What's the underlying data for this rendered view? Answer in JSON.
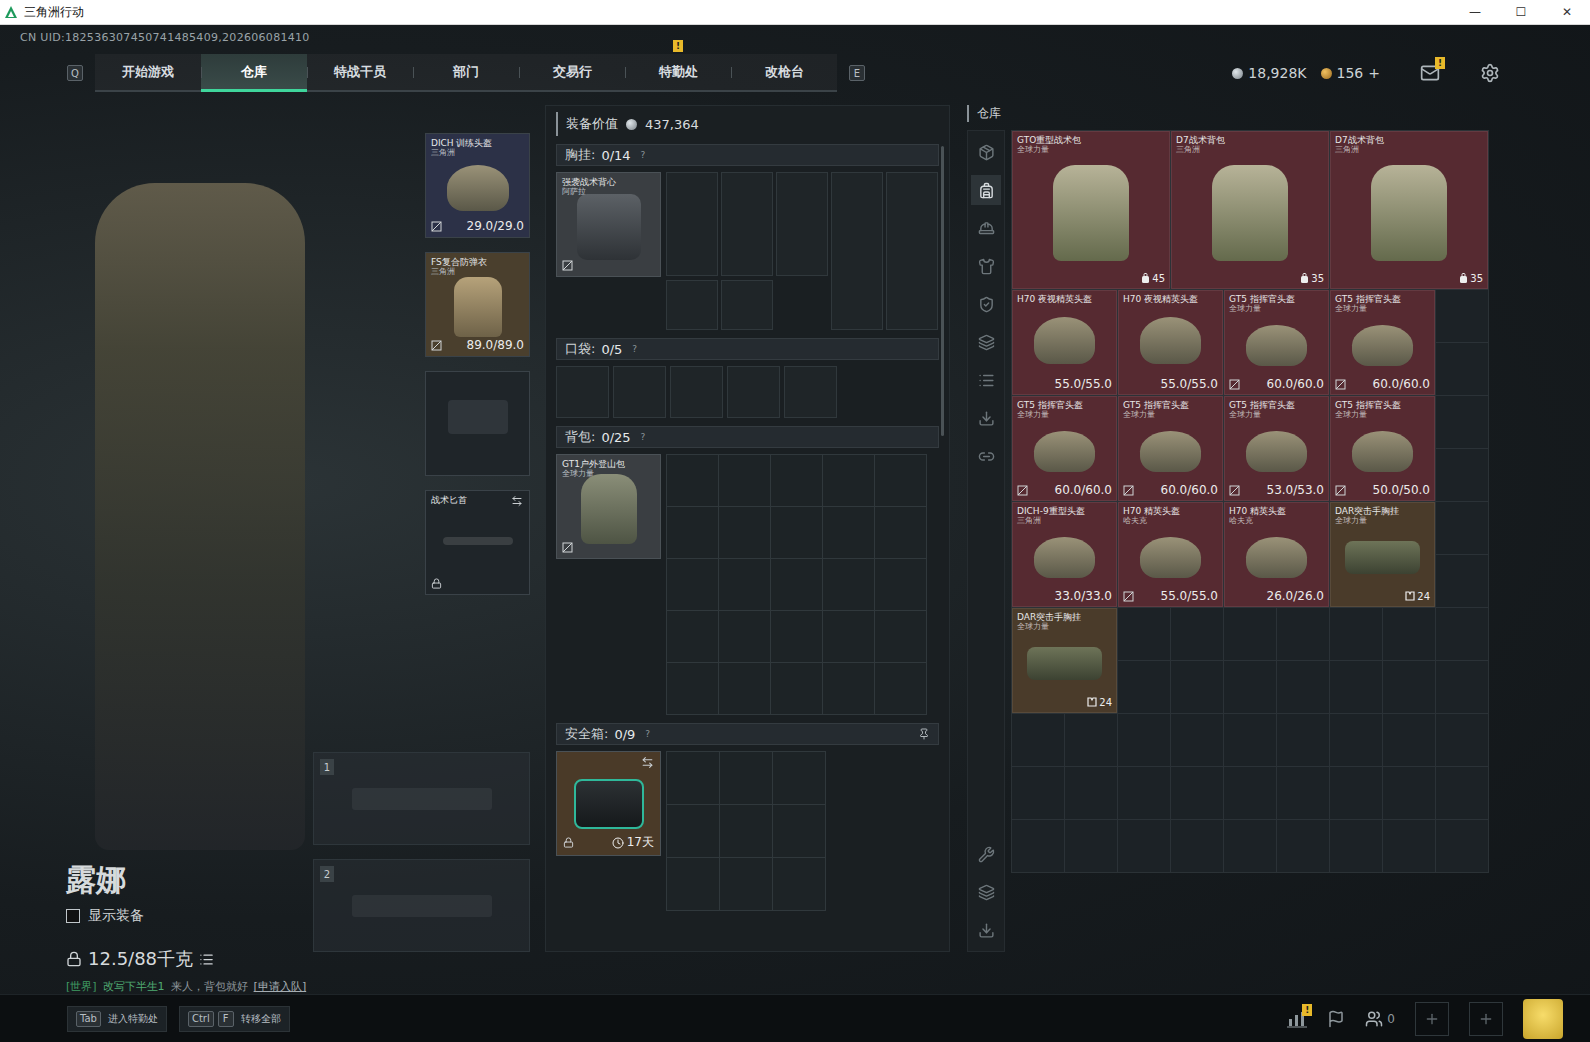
{
  "window": {
    "title": "三角洲行动",
    "controls": [
      "—",
      "☐",
      "✕"
    ]
  },
  "uid": "CN UID:182536307450741485409,202606081410",
  "nav": {
    "prev_key": "Q",
    "next_key": "E",
    "alert_mark": "!",
    "tabs": [
      {
        "label": "开始游戏",
        "selected": false,
        "alert": false
      },
      {
        "label": "仓库",
        "selected": true,
        "alert": false
      },
      {
        "label": "特战干员",
        "selected": false,
        "alert": false
      },
      {
        "label": "部门",
        "selected": false,
        "alert": false
      },
      {
        "label": "交易行",
        "selected": false,
        "alert": false
      },
      {
        "label": "特勤处",
        "selected": false,
        "alert": true
      },
      {
        "label": "改枪台",
        "selected": false,
        "alert": false
      }
    ]
  },
  "wallet": {
    "coins": "18,928K",
    "tokens": "156",
    "add": "+",
    "mail_alert": "!"
  },
  "operator": {
    "name": "露娜",
    "show_gear": {
      "label": "显示装备",
      "checked": false
    },
    "weight": "12.5/88千克"
  },
  "chat": {
    "channel": "[世界]",
    "user": "改写下半生1",
    "message": "来人，背包就好",
    "action": "[申请入队]"
  },
  "equipped": [
    {
      "kind": "helmet",
      "name": "DICH 训练头盔",
      "sub": "三角洲",
      "durability": "29.0/29.0",
      "color": "#2c3147",
      "empty": false,
      "locked": false,
      "marked": true
    },
    {
      "kind": "armor",
      "name": "FS复合防弹衣",
      "sub": "三角洲",
      "durability": "89.0/89.0",
      "color": "#4a3f2d",
      "empty": false,
      "locked": false,
      "marked": true
    },
    {
      "kind": "pistol",
      "color": "#1f2529",
      "empty": true,
      "locked": false,
      "marked": false
    },
    {
      "kind": "melee",
      "name": "战术匕首",
      "color": "#1f2529",
      "empty": false,
      "locked": true,
      "marked": false
    }
  ],
  "weapons": [
    {
      "slot": "1",
      "empty": true
    },
    {
      "slot": "2",
      "empty": true
    }
  ],
  "loadout": {
    "value_label": "装备价值",
    "value": "437,364",
    "rig": {
      "label": "胸挂:",
      "count": "0/14",
      "help": "?",
      "item": {
        "name": "强袭战术背心",
        "sub": "阿萨拉",
        "color": "#3a3e42",
        "marked": true
      }
    },
    "pockets": {
      "label": "口袋:",
      "count": "0/5",
      "help": "?",
      "slots": 5
    },
    "backpack": {
      "label": "背包:",
      "count": "0/25",
      "help": "?",
      "slots": 25,
      "item": {
        "name": "GT1户外登山包",
        "sub": "全球力量",
        "color": "#3a3e42",
        "marked": true
      }
    },
    "safe": {
      "label": "安全箱:",
      "count": "0/9",
      "help": "?",
      "slots": 9,
      "pinned": true,
      "item": {
        "timer": "17天",
        "color": "#4a3a28",
        "locked": true
      }
    }
  },
  "warehouse": {
    "title": "仓库",
    "items": [
      {
        "kind": "backpack",
        "name": "GTO重型战术包",
        "sub": "全球力量",
        "capacity": "45",
        "color": "#562a31",
        "marked": false
      },
      {
        "kind": "backpack",
        "name": "D7战术背包",
        "sub": "三角洲",
        "capacity": "35",
        "color": "#562a31",
        "marked": false
      },
      {
        "kind": "backpack",
        "name": "D7战术背包",
        "sub": "三角洲",
        "capacity": "35",
        "color": "#562a31",
        "marked": false
      },
      {
        "kind": "helmet",
        "name": "H70 夜视精英头盔",
        "durability": "55.0/55.0",
        "color": "#562a31",
        "marked": false
      },
      {
        "kind": "helmet",
        "name": "H70 夜视精英头盔",
        "durability": "55.0/55.0",
        "color": "#562a31",
        "marked": false
      },
      {
        "kind": "helmet",
        "name": "GT5 指挥官头盔",
        "sub": "全球力量",
        "durability": "60.0/60.0",
        "color": "#562a31",
        "marked": true
      },
      {
        "kind": "helmet",
        "name": "GT5 指挥官头盔",
        "sub": "全球力量",
        "durability": "60.0/60.0",
        "color": "#562a31",
        "marked": true
      },
      {
        "kind": "helmet",
        "name": "GT5 指挥官头盔",
        "sub": "全球力量",
        "durability": "60.0/60.0",
        "color": "#562a31",
        "marked": true
      },
      {
        "kind": "helmet",
        "name": "GT5 指挥官头盔",
        "sub": "全球力量",
        "durability": "60.0/60.0",
        "color": "#562a31",
        "marked": true
      },
      {
        "kind": "helmet",
        "name": "GT5 指挥官头盔",
        "sub": "全球力量",
        "durability": "53.0/53.0",
        "color": "#562a31",
        "marked": true
      },
      {
        "kind": "helmet",
        "name": "GT5 指挥官头盔",
        "sub": "全球力量",
        "durability": "50.0/50.0",
        "color": "#562a31",
        "marked": true
      },
      {
        "kind": "helmet",
        "name": "DICH-9重型头盔",
        "sub": "三角洲",
        "durability": "33.0/33.0",
        "color": "#562a31",
        "marked": false
      },
      {
        "kind": "helmet",
        "name": "H70 精英头盔",
        "sub": "哈夫克",
        "durability": "55.0/55.0",
        "color": "#562a31",
        "marked": true
      },
      {
        "kind": "helmet",
        "name": "H70 精英头盔",
        "sub": "哈夫克",
        "durability": "26.0/26.0",
        "color": "#562a31",
        "marked": false
      },
      {
        "kind": "rig",
        "name": "DAR突击手胸挂",
        "sub": "全球力量",
        "capacity": "24",
        "color": "#4a3b2a",
        "marked": false
      },
      {
        "kind": "rig",
        "name": "DAR突击手胸挂",
        "sub": "全球力量",
        "capacity": "24",
        "color": "#4a3b2a",
        "marked": false
      }
    ]
  },
  "bottom": {
    "hints": [
      {
        "keys": [
          "Tab"
        ],
        "label": "进入特勤处"
      },
      {
        "keys": [
          "Ctrl",
          "F"
        ],
        "label": "转移全部"
      }
    ],
    "stats_alert": "!",
    "friends": "0"
  }
}
